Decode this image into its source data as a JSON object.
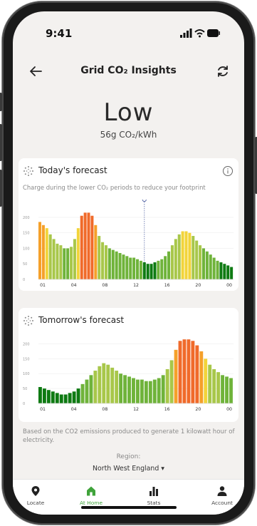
{
  "status_bar": {
    "time": "9:41"
  },
  "header": {
    "title": "Grid CO₂ Insights",
    "back_icon": "back-arrow-icon",
    "refresh_icon": "refresh-icon"
  },
  "summary": {
    "level": "Low",
    "intensity": "56g CO₂/kWh"
  },
  "today": {
    "title": "Today's forecast",
    "subtitle": "Charge during the lower CO₂ periods to reduce your footprint",
    "chart_data": {
      "type": "bar",
      "title": "Today's forecast",
      "ylim": [
        0,
        225
      ],
      "y_ticks": [
        "0",
        "50",
        "100",
        "150",
        "200"
      ],
      "x_ticks": [
        "01",
        "04",
        "08",
        "12",
        "16",
        "20",
        "00"
      ],
      "marker_index": 30,
      "values": [
        185,
        175,
        165,
        145,
        130,
        115,
        110,
        100,
        100,
        105,
        130,
        165,
        205,
        215,
        215,
        205,
        175,
        140,
        120,
        110,
        100,
        95,
        90,
        85,
        80,
        75,
        70,
        70,
        65,
        60,
        55,
        50,
        50,
        55,
        60,
        65,
        75,
        90,
        110,
        130,
        145,
        155,
        155,
        150,
        140,
        125,
        110,
        100,
        90,
        80,
        70,
        60,
        55,
        50,
        45,
        40
      ]
    },
    "info_icon": "info-icon"
  },
  "tomorrow": {
    "title": "Tomorrow's forecast",
    "chart_data": {
      "type": "bar",
      "title": "Tomorrow's forecast",
      "ylim": [
        0,
        225
      ],
      "y_ticks": [
        "0",
        "50",
        "100",
        "150",
        "200"
      ],
      "x_ticks": [
        "01",
        "04",
        "08",
        "12",
        "16",
        "20",
        "00"
      ],
      "values": [
        55,
        50,
        45,
        40,
        35,
        30,
        30,
        35,
        40,
        50,
        65,
        80,
        95,
        110,
        125,
        135,
        130,
        120,
        110,
        100,
        95,
        90,
        85,
        80,
        80,
        75,
        75,
        80,
        85,
        95,
        115,
        145,
        180,
        210,
        215,
        215,
        210,
        195,
        175,
        150,
        130,
        115,
        105,
        95,
        90,
        85
      ]
    }
  },
  "footnote": "Based on the CO2 emissions produced to generate 1 kilowatt hour of electricity.",
  "region": {
    "label": "Region:",
    "value": "North West England ▾"
  },
  "tabs": [
    {
      "label": "Locate",
      "icon": "location-pin-icon"
    },
    {
      "label": "At Home",
      "icon": "home-icon",
      "active": true
    },
    {
      "label": "Stats",
      "icon": "stats-icon"
    },
    {
      "label": "Account",
      "icon": "account-icon"
    }
  ],
  "colors": {
    "dark_green": "#0e7a12",
    "green": "#6fb33a",
    "light_green": "#a8c74a",
    "yellow": "#f2d43a",
    "orange": "#f5a02a",
    "red_orange": "#f06a2a",
    "accent": "#3fa33a"
  }
}
